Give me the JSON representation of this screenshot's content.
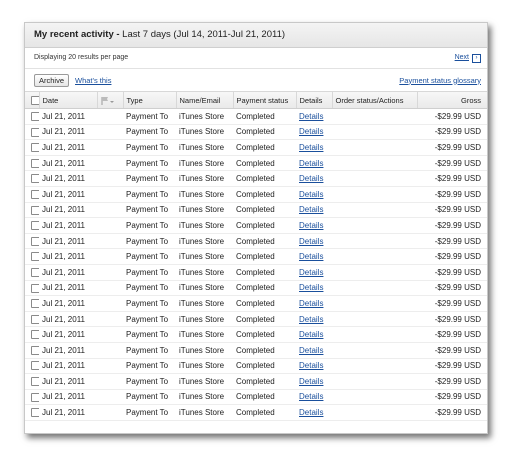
{
  "header": {
    "title_bold": "My recent activity -",
    "title_rest": " Last 7 days (Jul 14, 2011-Jul 21, 2011)"
  },
  "info": {
    "displaying": "Displaying 20 results per page",
    "next_label": "Next",
    "next_icon": "next-arrow-icon"
  },
  "toolbar": {
    "archive_label": "Archive",
    "whats_this": "What's this",
    "glossary": "Payment status glossary"
  },
  "table": {
    "columns": [
      "Date",
      "",
      "Type",
      "Name/Email",
      "Payment status",
      "Details",
      "Order status/Actions",
      "Gross"
    ],
    "rows": [
      {
        "date": "Jul 21, 2011",
        "type": "Payment To",
        "name": "iTunes Store",
        "status": "Completed",
        "details": "Details",
        "order": "",
        "gross": "-$29.99 USD"
      },
      {
        "date": "Jul 21, 2011",
        "type": "Payment To",
        "name": "iTunes Store",
        "status": "Completed",
        "details": "Details",
        "order": "",
        "gross": "-$29.99 USD"
      },
      {
        "date": "Jul 21, 2011",
        "type": "Payment To",
        "name": "iTunes Store",
        "status": "Completed",
        "details": "Details",
        "order": "",
        "gross": "-$29.99 USD"
      },
      {
        "date": "Jul 21, 2011",
        "type": "Payment To",
        "name": "iTunes Store",
        "status": "Completed",
        "details": "Details",
        "order": "",
        "gross": "-$29.99 USD"
      },
      {
        "date": "Jul 21, 2011",
        "type": "Payment To",
        "name": "iTunes Store",
        "status": "Completed",
        "details": "Details",
        "order": "",
        "gross": "-$29.99 USD"
      },
      {
        "date": "Jul 21, 2011",
        "type": "Payment To",
        "name": "iTunes Store",
        "status": "Completed",
        "details": "Details",
        "order": "",
        "gross": "-$29.99 USD"
      },
      {
        "date": "Jul 21, 2011",
        "type": "Payment To",
        "name": "iTunes Store",
        "status": "Completed",
        "details": "Details",
        "order": "",
        "gross": "-$29.99 USD"
      },
      {
        "date": "Jul 21, 2011",
        "type": "Payment To",
        "name": "iTunes Store",
        "status": "Completed",
        "details": "Details",
        "order": "",
        "gross": "-$29.99 USD"
      },
      {
        "date": "Jul 21, 2011",
        "type": "Payment To",
        "name": "iTunes Store",
        "status": "Completed",
        "details": "Details",
        "order": "",
        "gross": "-$29.99 USD"
      },
      {
        "date": "Jul 21, 2011",
        "type": "Payment To",
        "name": "iTunes Store",
        "status": "Completed",
        "details": "Details",
        "order": "",
        "gross": "-$29.99 USD"
      },
      {
        "date": "Jul 21, 2011",
        "type": "Payment To",
        "name": "iTunes Store",
        "status": "Completed",
        "details": "Details",
        "order": "",
        "gross": "-$29.99 USD"
      },
      {
        "date": "Jul 21, 2011",
        "type": "Payment To",
        "name": "iTunes Store",
        "status": "Completed",
        "details": "Details",
        "order": "",
        "gross": "-$29.99 USD"
      },
      {
        "date": "Jul 21, 2011",
        "type": "Payment To",
        "name": "iTunes Store",
        "status": "Completed",
        "details": "Details",
        "order": "",
        "gross": "-$29.99 USD"
      },
      {
        "date": "Jul 21, 2011",
        "type": "Payment To",
        "name": "iTunes Store",
        "status": "Completed",
        "details": "Details",
        "order": "",
        "gross": "-$29.99 USD"
      },
      {
        "date": "Jul 21, 2011",
        "type": "Payment To",
        "name": "iTunes Store",
        "status": "Completed",
        "details": "Details",
        "order": "",
        "gross": "-$29.99 USD"
      },
      {
        "date": "Jul 21, 2011",
        "type": "Payment To",
        "name": "iTunes Store",
        "status": "Completed",
        "details": "Details",
        "order": "",
        "gross": "-$29.99 USD"
      },
      {
        "date": "Jul 21, 2011",
        "type": "Payment To",
        "name": "iTunes Store",
        "status": "Completed",
        "details": "Details",
        "order": "",
        "gross": "-$29.99 USD"
      },
      {
        "date": "Jul 21, 2011",
        "type": "Payment To",
        "name": "iTunes Store",
        "status": "Completed",
        "details": "Details",
        "order": "",
        "gross": "-$29.99 USD"
      },
      {
        "date": "Jul 21, 2011",
        "type": "Payment To",
        "name": "iTunes Store",
        "status": "Completed",
        "details": "Details",
        "order": "",
        "gross": "-$29.99 USD"
      },
      {
        "date": "Jul 21, 2011",
        "type": "Payment To",
        "name": "iTunes Store",
        "status": "Completed",
        "details": "Details",
        "order": "",
        "gross": "-$29.99 USD"
      }
    ]
  },
  "colors": {
    "link": "#1a4f9c",
    "header_bg": "#e9e9e9"
  }
}
